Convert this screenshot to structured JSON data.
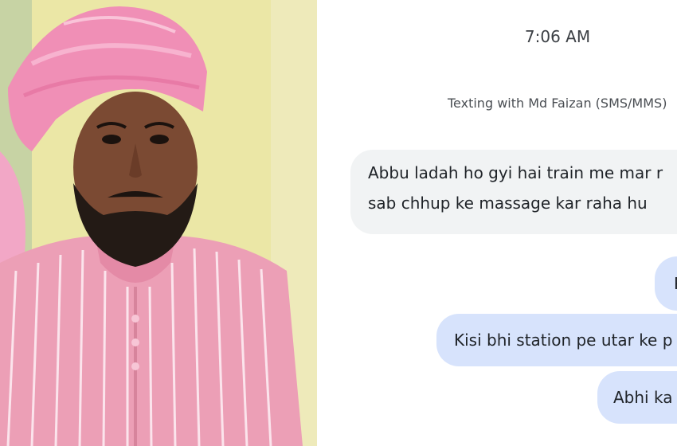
{
  "photo": {
    "subject": "portrait-man-pink-turban",
    "colors": {
      "background_wall": "#ebe7a6",
      "turban": "#f08fb6",
      "kurta": "#ec9fb6",
      "kurta_stripes": "#fbe4ec",
      "skin": "#7b4a33",
      "beard": "#231a15"
    }
  },
  "chat": {
    "time": "7:06 AM",
    "texting_with": "Texting with Md Faizan (SMS/MMS)",
    "incoming": {
      "line1": "Abbu ladah ho gyi hai train me mar r",
      "line2": "sab chhup ke massage kar raha hu"
    },
    "outgoing": [
      {
        "text": "P"
      },
      {
        "text": "Kisi bhi station pe utar ke p"
      },
      {
        "text": "Abhi ka"
      }
    ],
    "colors": {
      "incoming_bg": "#f1f3f4",
      "outgoing_bg": "#d7e3fc"
    }
  }
}
